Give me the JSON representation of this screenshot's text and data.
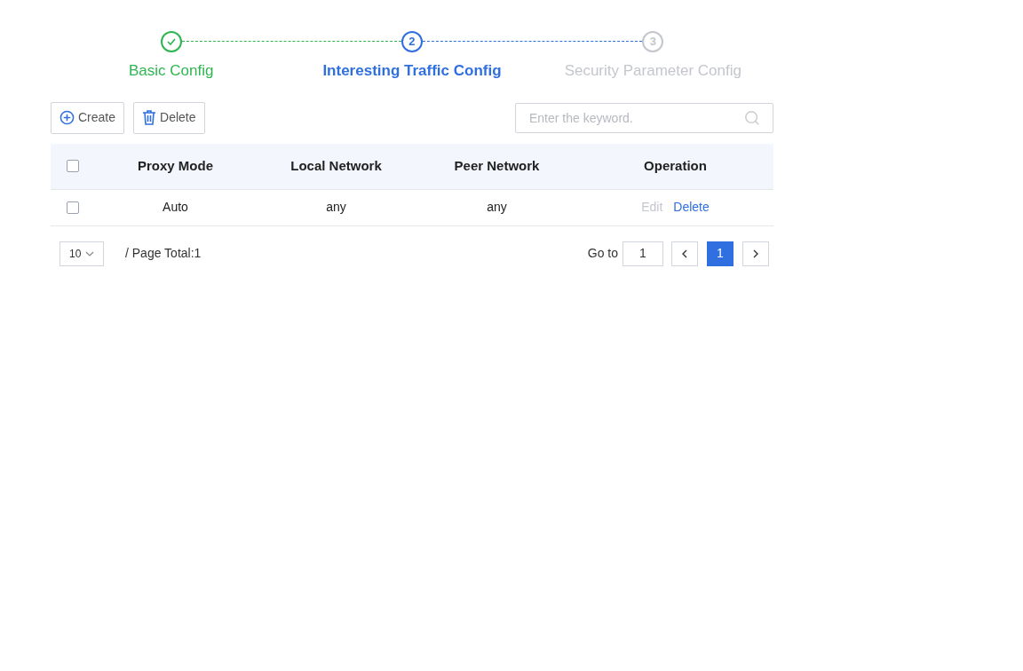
{
  "steps": [
    {
      "label": "Basic Config",
      "done": true,
      "selected": false
    },
    {
      "number": "2",
      "label": "Interesting Traffic Config",
      "done": false,
      "selected": true
    },
    {
      "number": "3",
      "label": "Security Parameter Config",
      "done": false,
      "selected": false
    }
  ],
  "toolbar": {
    "buttons": [
      {
        "kind": "create",
        "label": "Create"
      },
      {
        "kind": "delete",
        "label": "Delete"
      }
    ],
    "search": {
      "placeholder": "Enter the keyword."
    }
  },
  "table": {
    "select_all": {
      "checked": false
    },
    "columns": [
      "Proxy Mode",
      "Local Network",
      "Peer Network",
      "Operation"
    ],
    "rows": [
      {
        "checked": false,
        "cells": [
          "Auto",
          "any",
          "any"
        ],
        "actions": [
          {
            "label": "Edit",
            "disabled": true
          },
          {
            "label": "Delete",
            "disabled": false
          }
        ]
      }
    ]
  },
  "pagination": {
    "page_size": "10",
    "total": "/ Page Total:1",
    "goto_label": "Go to",
    "goto_value": "1",
    "pages": [
      {
        "label": "1",
        "selected": true
      }
    ]
  }
}
